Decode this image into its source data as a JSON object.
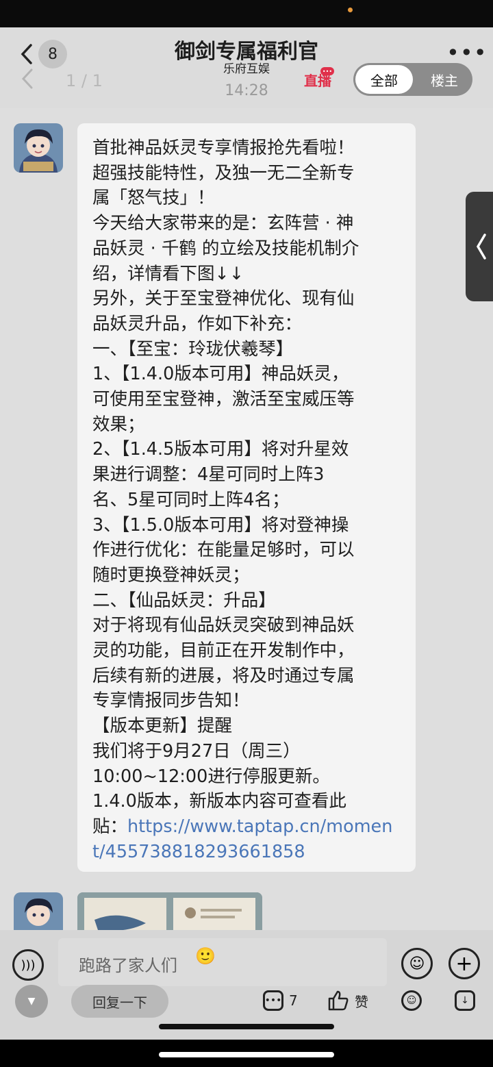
{
  "header": {
    "unread_count": "8",
    "page_indicator": "1 / 1",
    "title": "御剑专属福利官",
    "subtitle": "乐府互娱",
    "time": "14:28",
    "live_label": "直播",
    "more": "•••",
    "filter_tabs": [
      "全部",
      "楼主"
    ]
  },
  "message": {
    "lines": [
      "首批神品妖灵专享情报抢先看啦！",
      "超强技能特性，及独一无二全新专",
      "属「怒气技」！",
      "今天给大家带来的是：玄阵营 · 神",
      "品妖灵 · 千鹤 的立绘及技能机制介",
      "绍，详情看下图↓↓",
      "另外，关于至宝登神优化、现有仙",
      "品妖灵升品，作如下补充：",
      "一、【至宝：玲珑伏羲琴】",
      "1、【1.4.0版本可用】神品妖灵，",
      "可使用至宝登神，激活至宝威压等",
      "效果；",
      "2、【1.4.5版本可用】将对升星效",
      "果进行调整：4星可同时上阵3",
      "名、5星可同时上阵4名；",
      "3、【1.5.0版本可用】将对登神操",
      "作进行优化：在能量足够时，可以",
      "随时更换登神妖灵；",
      "二、【仙品妖灵：升品】",
      "对于将现有仙品妖灵突破到神品妖",
      "灵的功能，目前正在开发制作中，",
      "后续有新的进展，将及时通过专属",
      "专享情报同步告知！",
      "【版本更新】提醒",
      "我们将于9月27日（周三）",
      "10:00~12:00进行停服更新。",
      "1.4.0版本，新版本内容可查看此"
    ],
    "link_prefix": "贴：",
    "link_line1": "https://www.taptap.cn/momen",
    "link_line2": "t/455738818293661858"
  },
  "composer": {
    "placeholder": "跑路了家人们",
    "reply_label": "回复一下",
    "comment_count": "7",
    "like_label": "赞"
  },
  "icons": {
    "back": "chevron-left-icon",
    "side_tab": "chevron-left-icon",
    "voice": "voice-icon",
    "emoji": "smiley-icon",
    "plus": "plus-icon",
    "comment": "comment-icon",
    "like": "thumbs-up-icon",
    "download": "download-icon"
  },
  "colors": {
    "link": "#4a76b8",
    "live": "#e0304a"
  }
}
